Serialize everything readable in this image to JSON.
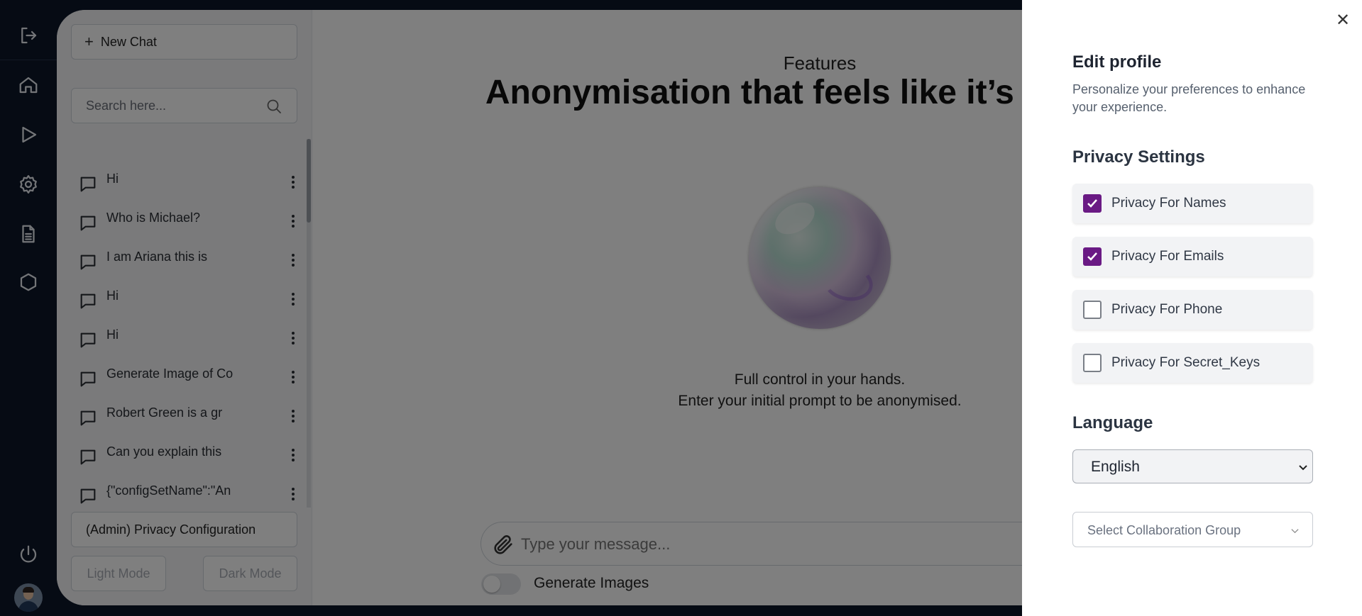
{
  "sidebar": {
    "new_chat_label": "New Chat",
    "search_placeholder": "Search here...",
    "chats": [
      {
        "label": "Hi"
      },
      {
        "label": "Who is Michael?"
      },
      {
        "label": "I am Ariana this is"
      },
      {
        "label": "Hi"
      },
      {
        "label": "Hi"
      },
      {
        "label": "Generate Image of Co"
      },
      {
        "label": "Robert Green is a gr"
      },
      {
        "label": "Can you explain this"
      },
      {
        "label": "{\"configSetName\":\"An"
      }
    ],
    "privacy_config_label": "(Admin) Privacy Configuration",
    "light_mode_label": "Light Mode",
    "dark_mode_label": "Dark Mode"
  },
  "rail": {
    "icons": [
      "logout-icon",
      "home-icon",
      "play-icon",
      "settings-icon",
      "document-icon",
      "hexagon-icon",
      "power-icon"
    ]
  },
  "main": {
    "features_label": "Features",
    "hero_title": "Anonymisation that feels like it’s fr future",
    "tagline_1": "Full control in your hands.",
    "tagline_2": "Enter your initial prompt to be anonymised.",
    "message_placeholder": "Type your message...",
    "generate_images_label": "Generate Images",
    "generate_images_on": false
  },
  "edit_profile": {
    "title": "Edit profile",
    "subtitle": "Personalize your preferences to enhance your experience.",
    "privacy_heading": "Privacy Settings",
    "privacy_options": [
      {
        "label": "Privacy For Names",
        "checked": true
      },
      {
        "label": "Privacy For Emails",
        "checked": true
      },
      {
        "label": "Privacy For Phone",
        "checked": false
      },
      {
        "label": "Privacy For Secret_Keys",
        "checked": false
      }
    ],
    "language_heading": "Language",
    "language_value": "English",
    "collab_placeholder": "Select Collaboration Group"
  },
  "colors": {
    "rail_bg": "#0d1729",
    "checkbox_accent": "#6a1a84"
  }
}
